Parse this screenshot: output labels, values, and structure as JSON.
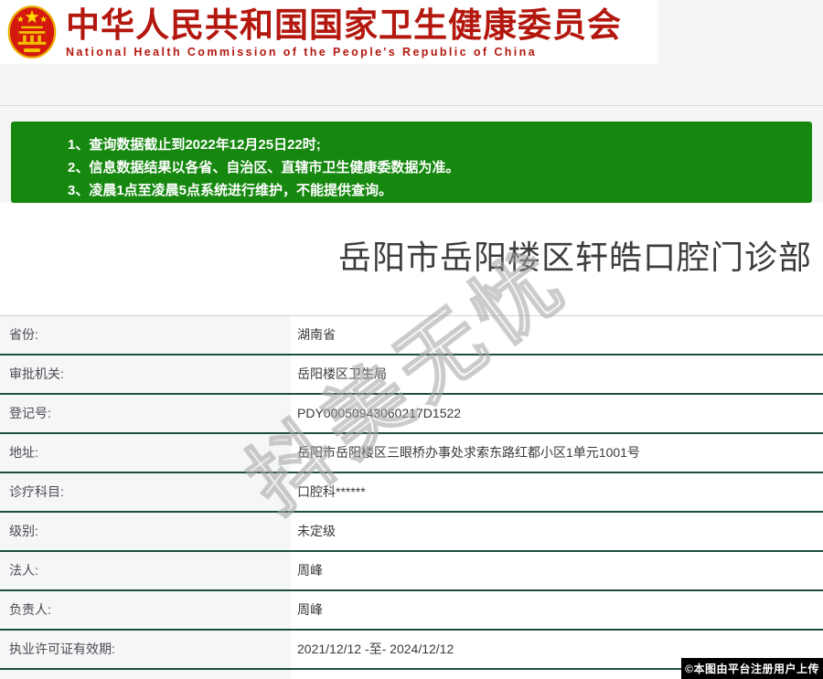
{
  "header": {
    "emblem_icon": "china-national-emblem",
    "title_cn": "中华人民共和国国家卫生健康委员会",
    "title_en": "National Health Commission of the People's Republic of China"
  },
  "notice": {
    "bg_color": "#16880f",
    "lines": [
      "1、查询数据截止到2022年12月25日22时;",
      "2、信息数据结果以各省、自治区、直辖市卫生健康委数据为准。",
      "3、凌晨1点至凌晨5点系统进行维护，不能提供查询。"
    ]
  },
  "result": {
    "org_title": "岳阳市岳阳楼区轩皓口腔门诊部",
    "fields": [
      {
        "label": "省份:",
        "value": "湖南省"
      },
      {
        "label": "审批机关:",
        "value": "岳阳楼区卫生局"
      },
      {
        "label": "登记号:",
        "value": "PDY00050943060217D1522"
      },
      {
        "label": "地址:",
        "value": "岳阳市岳阳楼区三眼桥办事处求索东路红都小区1单元1001号"
      },
      {
        "label": "诊疗科目:",
        "value": "口腔科******"
      },
      {
        "label": "级别:",
        "value": "未定级"
      },
      {
        "label": "法人:",
        "value": "周峰"
      },
      {
        "label": "负责人:",
        "value": "周峰"
      },
      {
        "label": "执业许可证有效期:",
        "value": "2021/12/12 -至- 2024/12/12"
      }
    ]
  },
  "watermark": {
    "text": "抖美无忧"
  },
  "footer": {
    "upload_tag": "©本图由平台注册用户上传"
  },
  "colors": {
    "brand_red": "#b3170e",
    "notice_green": "#16880f",
    "table_divider_green": "#1e4e42",
    "label_cell_bg": "#f5f6f6",
    "top_band_bg": "#f4f5f5",
    "tag_bg": "#000000"
  }
}
